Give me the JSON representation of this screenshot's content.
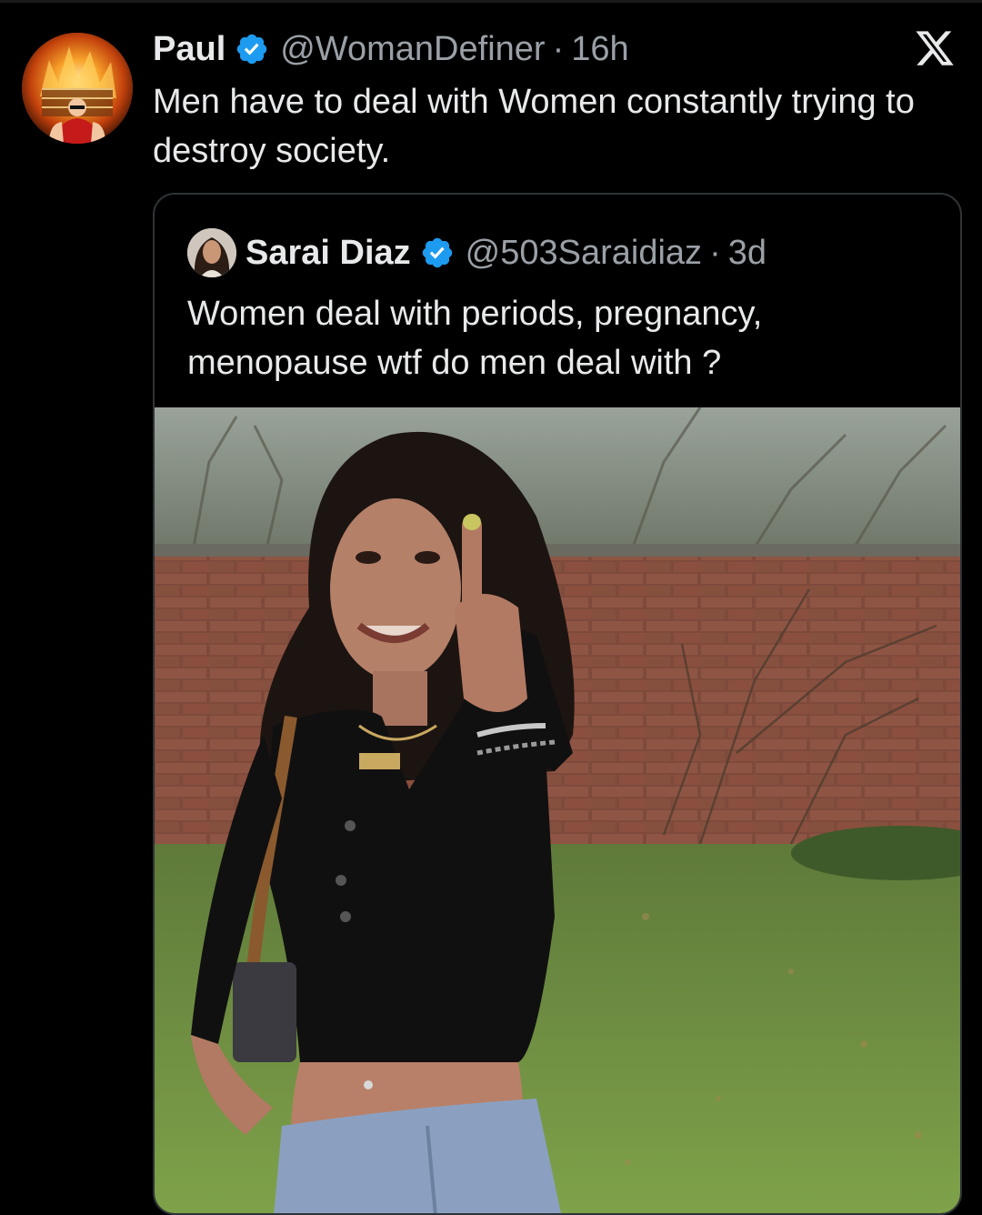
{
  "tweet": {
    "author_name": "Paul",
    "author_handle": "@WomanDefiner",
    "separator": "·",
    "time": "16h",
    "text": "Men have to deal with Women constantly trying to destroy society.",
    "verified_icon": "verified-badge-icon",
    "platform_icon": "x-logo-icon"
  },
  "quoted": {
    "author_name": "Sarai Diaz",
    "author_handle": "@503Saraidiaz",
    "separator": "·",
    "time": "3d",
    "text": "Women deal with periods, pregnancy, menopause wtf do men deal with ?",
    "verified_icon": "verified-badge-icon",
    "media": "photo"
  },
  "colors": {
    "background": "#000000",
    "text": "#e7e9ea",
    "secondary_text": "#9aa0a6",
    "verified": "#1d9bf0",
    "border": "#2f3336"
  }
}
